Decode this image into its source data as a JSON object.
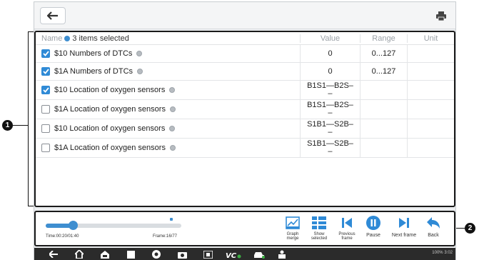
{
  "header": {
    "back_icon": "back-arrow-icon",
    "print_icon": "printer-icon"
  },
  "table": {
    "name_col": "Name",
    "selected_text": "3 items selected",
    "value_col": "Value",
    "range_col": "Range",
    "unit_col": "Unit",
    "rows": [
      {
        "name": "$10 Numbers of DTCs",
        "checked": true,
        "value": "0",
        "range": "0...127",
        "unit": ""
      },
      {
        "name": "$1A Numbers of DTCs",
        "checked": true,
        "value": "0",
        "range": "0...127",
        "unit": ""
      },
      {
        "name": "$10 Location of oxygen sensors",
        "checked": true,
        "value": "B1S1—B2S–\n–",
        "range": "",
        "unit": ""
      },
      {
        "name": "$1A Location of oxygen sensors",
        "checked": false,
        "value": "B1S1—B2S–\n–",
        "range": "",
        "unit": ""
      },
      {
        "name": "$10 Location of oxygen sensors",
        "checked": false,
        "value": "S1B1—S2B–\n–",
        "range": "",
        "unit": ""
      },
      {
        "name": "$1A Location of oxygen sensors",
        "checked": false,
        "value": "S1B1—S2B–\n–",
        "range": "",
        "unit": ""
      }
    ]
  },
  "playback": {
    "time": "Time:00:20/01:40",
    "frame": "Frame:16/77",
    "progress": 0.2,
    "controls": {
      "graph_merge": "Graph merge",
      "show_selected": "Show selected",
      "previous_frame": "Previous frame",
      "pause": "Pause",
      "next_frame": "Next frame",
      "back": "Back"
    }
  },
  "status_bar": {
    "text": "100%",
    "time": "3:02"
  },
  "callouts": {
    "one": "1",
    "two": "2"
  },
  "colors": {
    "accent": "#2f8ad6",
    "navbar": "#2b2b2b"
  }
}
